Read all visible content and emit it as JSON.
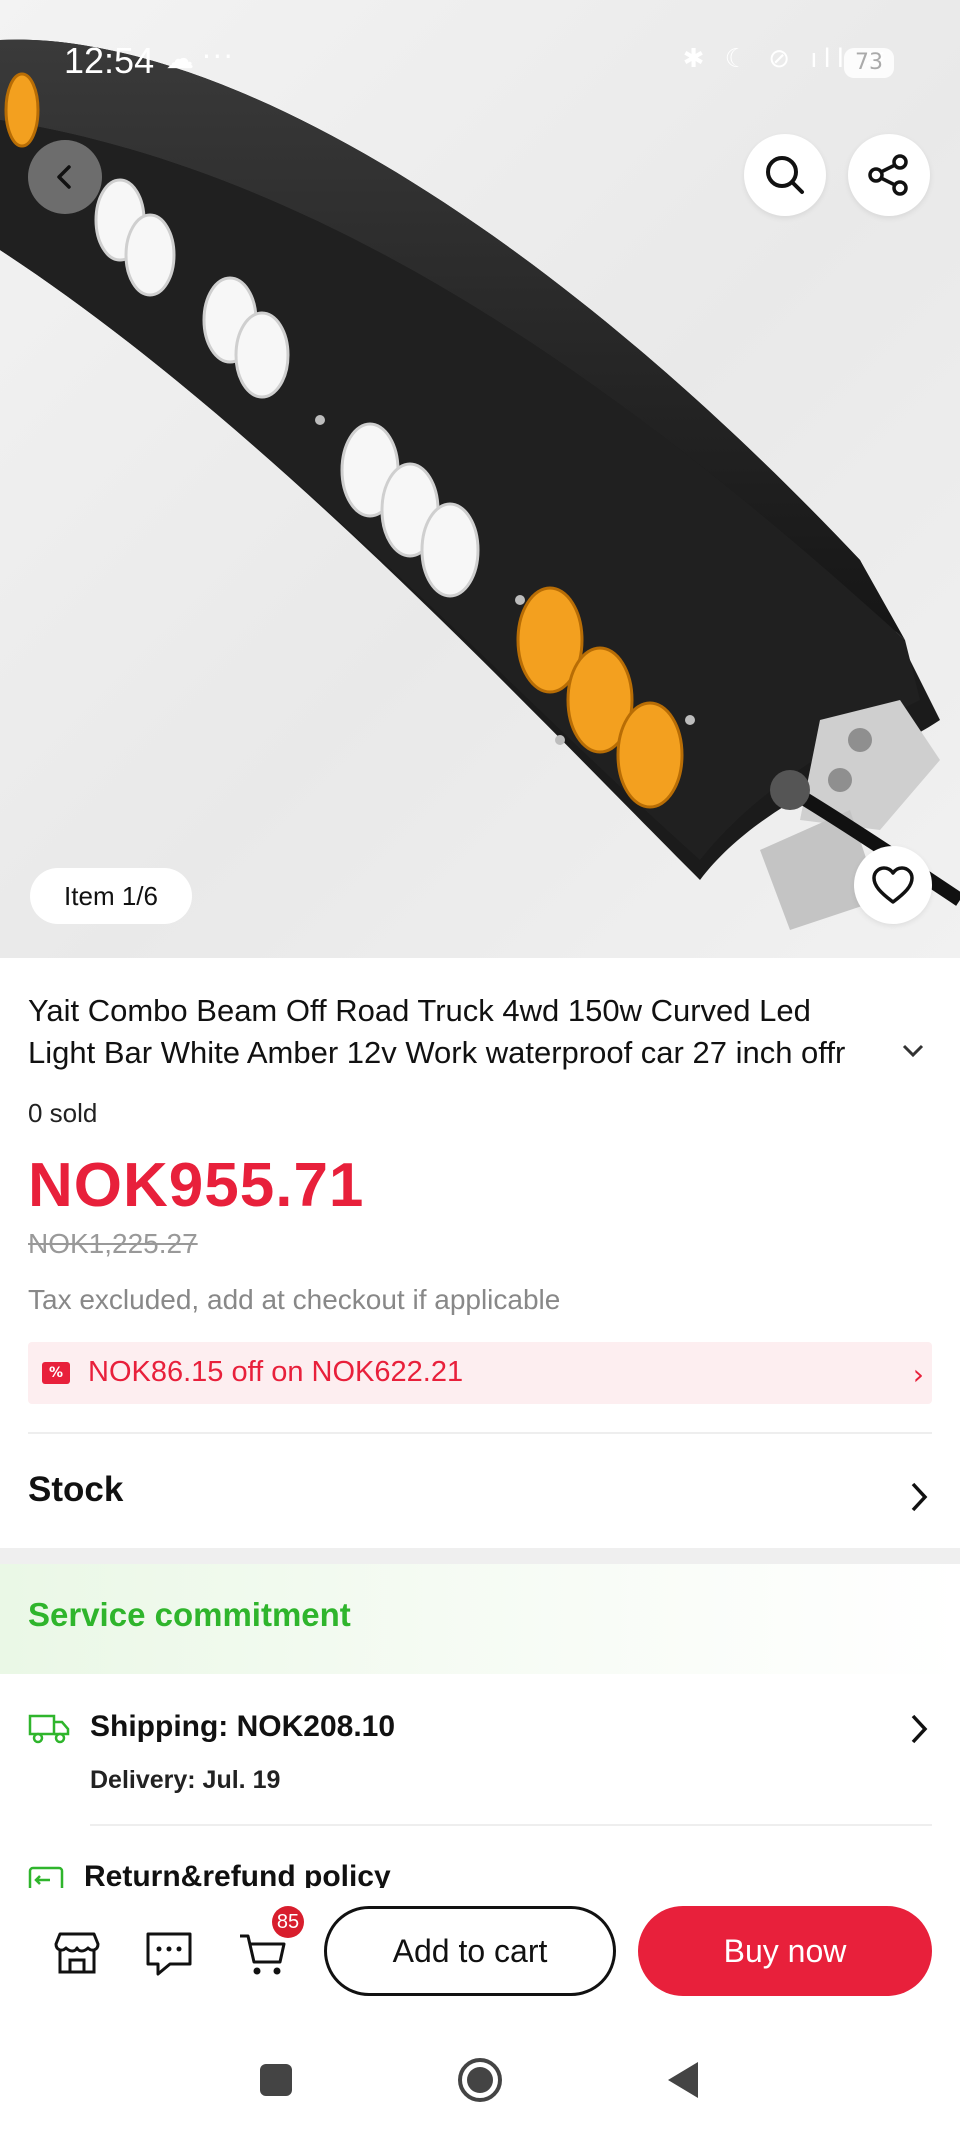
{
  "status_bar": {
    "time": "12:54",
    "battery": "73"
  },
  "hero": {
    "item_counter": "Item 1/6"
  },
  "product": {
    "title_line1": "Yait Combo Beam Off Road Truck 4wd 150w Curved Led",
    "title_line2": "Light Bar White Amber 12v Work waterproof car 27 inch offr",
    "sold": "0 sold",
    "price": "NOK955.71",
    "original_price": "NOK1,225.27",
    "tax_note": "Tax excluded, add at checkout if applicable",
    "coupon": "NOK86.15 off on NOK622.21"
  },
  "stock": {
    "label": "Stock"
  },
  "service": {
    "heading": "Service commitment",
    "shipping": "Shipping: NOK208.10",
    "delivery": "Delivery: Jul. 19",
    "return_policy": "Return&refund policy"
  },
  "bottom_bar": {
    "cart_count": "85",
    "add_to_cart": "Add to cart",
    "buy_now": "Buy now"
  },
  "colors": {
    "accent": "#e8203b",
    "service_green": "#2fb52c",
    "amber": "#f3a01f"
  },
  "icons": [
    "back-icon",
    "search-icon",
    "share-icon",
    "heart-icon",
    "chevron-down-icon",
    "coupon-icon",
    "chevron-right-icon",
    "truck-icon",
    "return-icon",
    "store-icon",
    "chat-icon",
    "cart-icon",
    "nav-square-icon",
    "nav-home-icon",
    "nav-back-icon"
  ]
}
